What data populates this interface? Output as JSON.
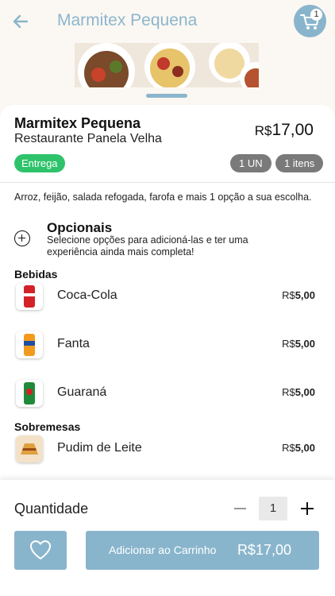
{
  "header": {
    "title": "Marmitex Pequena",
    "cart_count": "1"
  },
  "product": {
    "name": "Marmitex Pequena",
    "restaurant": "Restaurante Panela Velha",
    "price_currency": "R$",
    "price_value": "17,00",
    "delivery_badge": "Entrega",
    "unit_pill": "1 UN",
    "items_pill": "1 itens",
    "description": "Arroz, feijão, salada refogada, farofa e mais 1 opção a sua escolha."
  },
  "optionals": {
    "title": "Opcionais",
    "subtitle": "Selecione opções para adicioná-las e ter uma experiência ainda mais completa!"
  },
  "sections": {
    "bebidas": {
      "title": "Bebidas",
      "items": [
        {
          "name": "Coca-Cola",
          "currency": "R$",
          "price": "5,00"
        },
        {
          "name": "Fanta",
          "currency": "R$",
          "price": "5,00"
        },
        {
          "name": "Guaraná",
          "currency": "R$",
          "price": "5,00"
        }
      ]
    },
    "sobremesas": {
      "title": "Sobremesas",
      "items": [
        {
          "name": "Pudim de Leite",
          "currency": "R$",
          "price": "5,00"
        }
      ]
    }
  },
  "footer": {
    "quantity_label": "Quantidade",
    "quantity_value": "1",
    "add_label": "Adicionar ao Carrinho",
    "add_price": "R$17,00"
  },
  "colors": {
    "accent": "#89b5cc",
    "delivery_green": "#2ec36b",
    "pill_gray": "#7a7a7a",
    "background": "#fbf7f2"
  },
  "icons": {
    "back": "arrow-left-icon",
    "cart": "cart-icon",
    "optionals": "plus-circle-icon",
    "favorite": "heart-icon",
    "minus": "minus-icon",
    "plus": "plus-icon"
  }
}
